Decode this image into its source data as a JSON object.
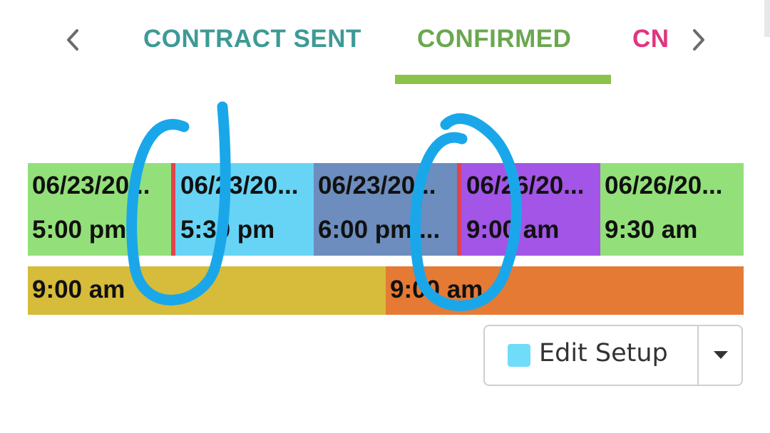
{
  "colors": {
    "tab_sent": "#3d9a96",
    "tab_confirmed": "#6aa84f",
    "tab_cn": "#e0357f",
    "underline": "#8bc34a",
    "arrow": "#6b6b6b",
    "marker": "#e0444f",
    "annotation": "#1aa7ea"
  },
  "tabs": {
    "prev_icon": "chevron-left-icon",
    "next_icon": "chevron-right-icon",
    "items": [
      {
        "label": "CONTRACT SENT",
        "active": false
      },
      {
        "label": "CONFIRMED",
        "active": true
      },
      {
        "label": "CN",
        "active": false
      }
    ]
  },
  "schedule": {
    "slots": [
      {
        "date": "06/23/20...",
        "time": "5:00 pm",
        "color": "#93e07a",
        "marker": false
      },
      {
        "date": "06/23/20...",
        "time": "5:30 pm",
        "color": "#67d4f5",
        "marker": true
      },
      {
        "date": "06/23/20...",
        "time": "6:00 pm ...",
        "color": "#6c8dbd",
        "marker": false
      },
      {
        "date": "06/26/20...",
        "time": "9:00 am",
        "color": "#a255e6",
        "marker": true
      },
      {
        "date": "06/26/20...",
        "time": "9:30 am",
        "color": "#93e07a",
        "marker": false
      }
    ],
    "blocks": [
      {
        "time": "9:00 am",
        "color": "#d6bc3a"
      },
      {
        "time": "9:00 am",
        "color": "#e57a34"
      }
    ]
  },
  "edit_setup": {
    "label": "Edit Setup",
    "swatch_color": "#6fdcf9",
    "dropdown_icon": "caret-down-icon"
  }
}
